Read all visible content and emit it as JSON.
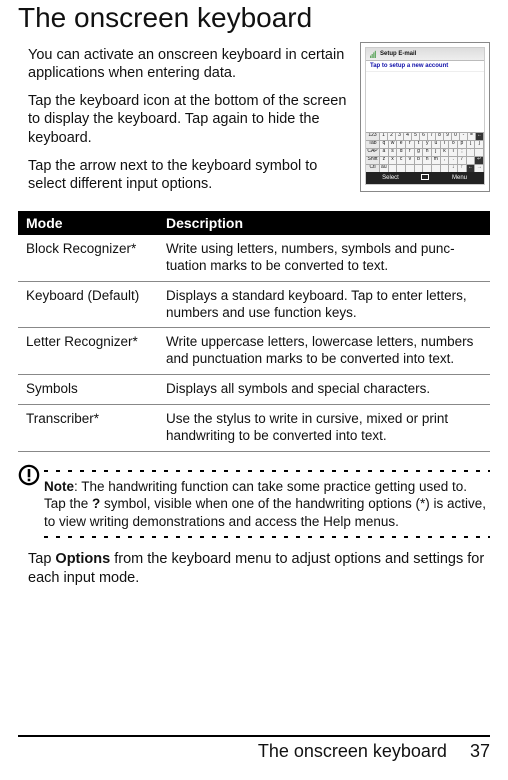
{
  "heading": "The onscreen keyboard",
  "intro": {
    "p1": "You can activate an onscreen keyboard in certain applications when entering data.",
    "p2": "Tap the keyboard icon at the bottom of the screen to display the keyboard. Tap again to hide the keyboard.",
    "p3": "Tap the arrow next to the keyboard symbol to select different input options."
  },
  "thumb": {
    "title": "Setup E-mail",
    "subtitle": "Tap to setup a new account",
    "soft_left": "Select",
    "soft_right": "Menu",
    "rows": {
      "num": {
        "label": "123",
        "keys": [
          "1",
          "2",
          "3",
          "4",
          "5",
          "6",
          "7",
          "8",
          "9",
          "0",
          "-",
          "=",
          "←"
        ]
      },
      "tab": {
        "label": "Tab",
        "keys": [
          "q",
          "w",
          "e",
          "r",
          "t",
          "y",
          "u",
          "i",
          "o",
          "p",
          "[",
          "]"
        ]
      },
      "cap": {
        "label": "CAP",
        "keys": [
          "a",
          "s",
          "d",
          "f",
          "g",
          "h",
          "j",
          "k",
          "l",
          ";",
          "'",
          " "
        ]
      },
      "shift": {
        "label": "Shift",
        "keys": [
          "z",
          "x",
          "c",
          "v",
          "b",
          "n",
          "m",
          ",",
          ".",
          "/",
          "",
          "↵"
        ]
      },
      "ctl": {
        "label": "Ctl",
        "keys": [
          "áü",
          "´",
          "",
          "",
          "",
          "",
          "",
          "",
          "↓",
          "↑",
          "←",
          "→"
        ]
      }
    }
  },
  "table": {
    "head": {
      "mode": "Mode",
      "desc": "Description"
    },
    "rows": [
      {
        "mode": "Block Recognizer*",
        "desc": "Write using letters, numbers, symbols and punc­tuation marks to be converted to text."
      },
      {
        "mode": "Keyboard (Default)",
        "desc": "Displays a standard keyboard. Tap to enter letters, numbers and use function keys."
      },
      {
        "mode": "Letter Recognizer*",
        "desc": "Write uppercase letters, lowercase letters, numbers and punctuation marks to be converted into text."
      },
      {
        "mode": "Symbols",
        "desc": "Displays all symbols and special characters."
      },
      {
        "mode": "Transcriber*",
        "desc": "Use the stylus to write in cursive, mixed or print handwriting to be converted into text."
      }
    ]
  },
  "note": {
    "label": "Note",
    "q": "?",
    "text_a": ": The handwriting function can take some practice getting used to. Tap the ",
    "text_b": " symbol, visible when one of the handwriting options (*) is active, to view writing demonstrations and access the Help menus."
  },
  "after": {
    "options_word": "Options",
    "prefix": "Tap ",
    "suffix": " from the keyboard menu to adjust options and settings for each input mode."
  },
  "footer": {
    "title": "The onscreen keyboard",
    "page": "37"
  }
}
